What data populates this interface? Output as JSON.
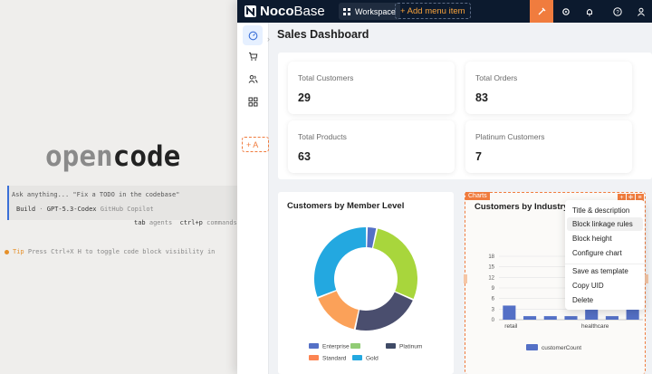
{
  "terminal": {
    "logo_dim": "open",
    "logo_bold": "code",
    "prompt_placeholder": "Ask anything... \"Fix a TODO in the codebase\"",
    "build_label": "Build",
    "build_sep": "·",
    "build_model": "GPT-5.3-Codex",
    "build_provider": "GitHub Copilot",
    "hint_tab": "tab",
    "hint_agents": "agents",
    "hint_ctrlp": "ctrl+p",
    "hint_commands": "commands",
    "tip_label": "Tip",
    "tip_text": "Press Ctrl+X H to toggle code block visibility in"
  },
  "app": {
    "brand_a": "Noco",
    "brand_b": "Base",
    "workspace_label": "Workspace",
    "add_menu_label": "+ Add menu item",
    "nav_add_label": "+ A",
    "page_title": "Sales Dashboard",
    "stats": [
      {
        "label": "Total Customers",
        "value": "29"
      },
      {
        "label": "Total Orders",
        "value": "83"
      },
      {
        "label": "Total Products",
        "value": "63"
      },
      {
        "label": "Platinum Customers",
        "value": "7"
      }
    ],
    "chart1_title": "Customers by Member Level",
    "chart2_title": "Customers by Industry",
    "charts_tag": "Charts",
    "context_menu": [
      "Title & description",
      "Block linkage rules",
      "Block height",
      "Configure chart",
      "Save as template",
      "Copy UID",
      "Delete"
    ]
  },
  "chart_data": [
    {
      "type": "pie",
      "title": "Customers by Member Level",
      "categories": [
        "Enterprise",
        "Gold",
        "Platinum",
        "Standard"
      ],
      "values": [
        1,
        8,
        7,
        5
      ],
      "legend": [
        "Enterprise",
        "",
        "Platinum",
        "Standard",
        "Gold"
      ],
      "colors": [
        "#5470c6",
        "#91cc75",
        "#3f4a66",
        "#fc8452",
        "#23a8e0"
      ],
      "ring_colors": [
        "#5470c6",
        "#a8d63c",
        "#4a4e6e",
        "#fba159",
        "#23a8e0"
      ],
      "ring_values": [
        1,
        9,
        7,
        5,
        10
      ]
    },
    {
      "type": "bar",
      "title": "Customers by Industry",
      "categories": [
        "retail",
        "",
        "",
        "",
        "healthcare",
        "",
        ""
      ],
      "values": [
        4,
        1,
        1,
        1,
        3,
        1,
        3
      ],
      "yticks": [
        0,
        3,
        6,
        9,
        12,
        15,
        18
      ],
      "ylim": [
        0,
        18
      ],
      "series": [
        {
          "name": "customerCount"
        }
      ],
      "color": "#5470c6"
    }
  ]
}
